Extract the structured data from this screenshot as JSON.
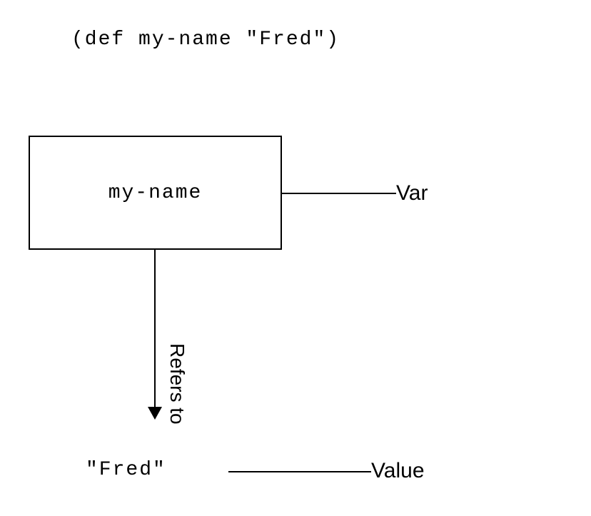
{
  "code_expression": "(def my-name \"Fred\")",
  "var_box_text": "my-name",
  "var_label": "Var",
  "arrow_label": "Refers to",
  "value_text": "\"Fred\"",
  "value_label": "Value"
}
